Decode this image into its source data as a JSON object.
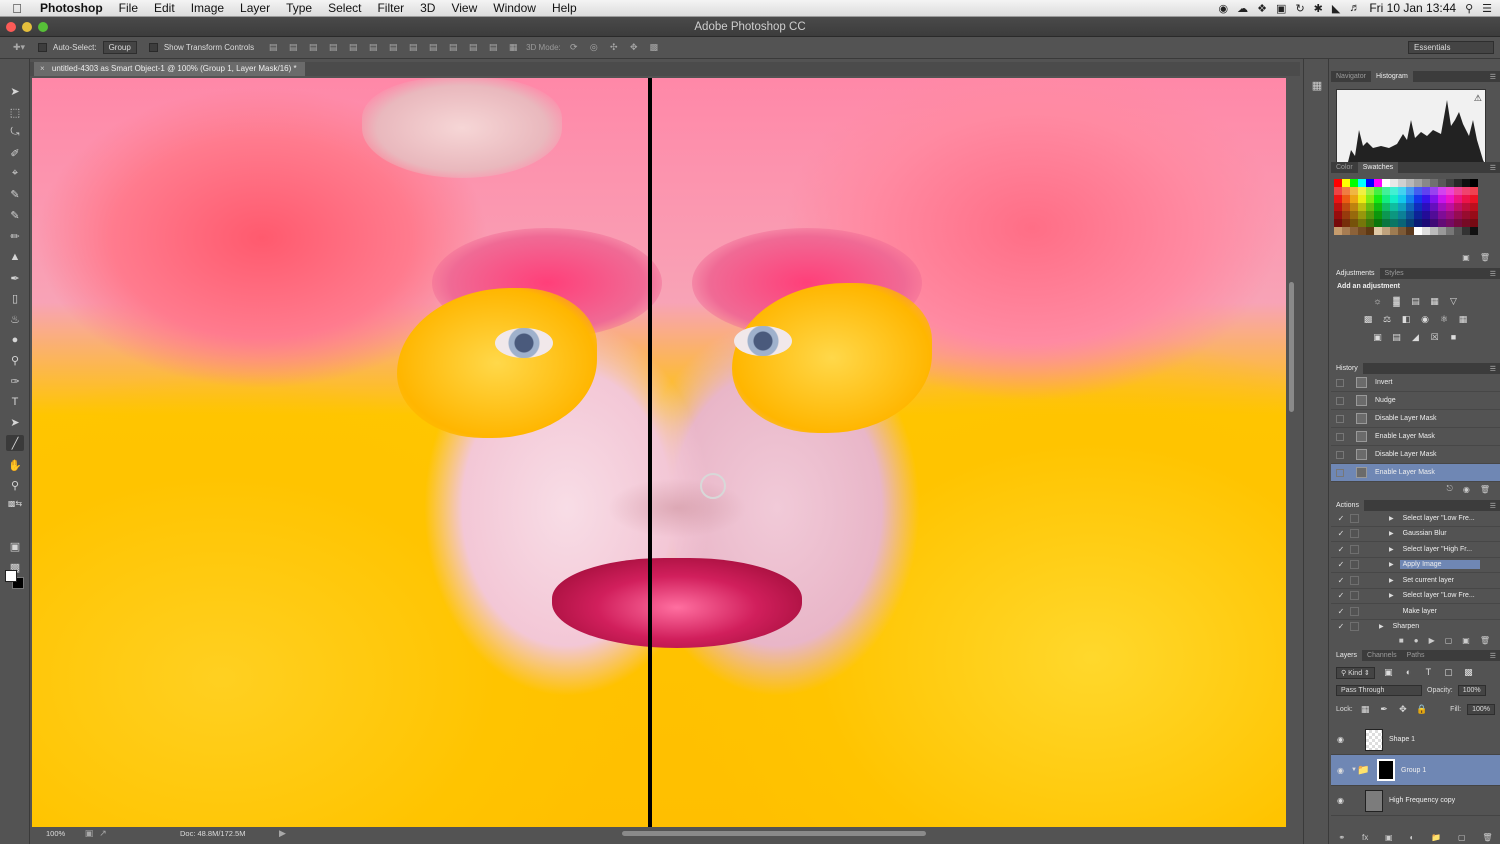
{
  "menubar": {
    "app": "Photoshop",
    "items": [
      "File",
      "Edit",
      "Image",
      "Layer",
      "Type",
      "Select",
      "Filter",
      "3D",
      "View",
      "Window",
      "Help"
    ],
    "clock": "Fri 10 Jan  13:44"
  },
  "window": {
    "title": "Adobe Photoshop CC"
  },
  "options": {
    "auto_select_label": "Auto-Select:",
    "auto_select_value": "Group",
    "show_transform_label": "Show Transform Controls",
    "mode_3d_label": "3D Mode:",
    "workspace": "Essentials"
  },
  "document": {
    "tab_title": "untitled-4303 as Smart Object-1 @ 100% (Group 1, Layer Mask/16) *"
  },
  "status": {
    "zoom": "100%",
    "doc_size": "Doc: 48.8M/172.5M"
  },
  "panels": {
    "navigator_tabs": [
      "Navigator",
      "Histogram"
    ],
    "color_tabs": [
      "Color",
      "Swatches"
    ],
    "adjustments_tabs": [
      "Adjustments",
      "Styles"
    ],
    "adjustments_title": "Add an adjustment",
    "history_tab": "History",
    "history_items": [
      "Invert",
      "Nudge",
      "Disable Layer Mask",
      "Enable Layer Mask",
      "Disable Layer Mask",
      "Enable Layer Mask"
    ],
    "actions_tab": "Actions",
    "action_items": [
      "Select layer \"Low Fre...",
      "Gaussian Blur",
      "Select layer \"High Fr...",
      "Apply Image",
      "Set current layer",
      "Select layer \"Low Fre...",
      "Make layer",
      "Sharpen"
    ],
    "layers_tabs": [
      "Layers",
      "Channels",
      "Paths"
    ],
    "layers_filter": "Kind",
    "blend_mode": "Pass Through",
    "opacity_label": "Opacity:",
    "opacity_value": "100%",
    "lock_label": "Lock:",
    "fill_label": "Fill:",
    "fill_value": "100%",
    "layers": [
      "Shape 1",
      "Group 1",
      "High Frequency copy"
    ]
  },
  "colors": {
    "selection": "#6f87b4",
    "panel_bg": "#535353"
  }
}
